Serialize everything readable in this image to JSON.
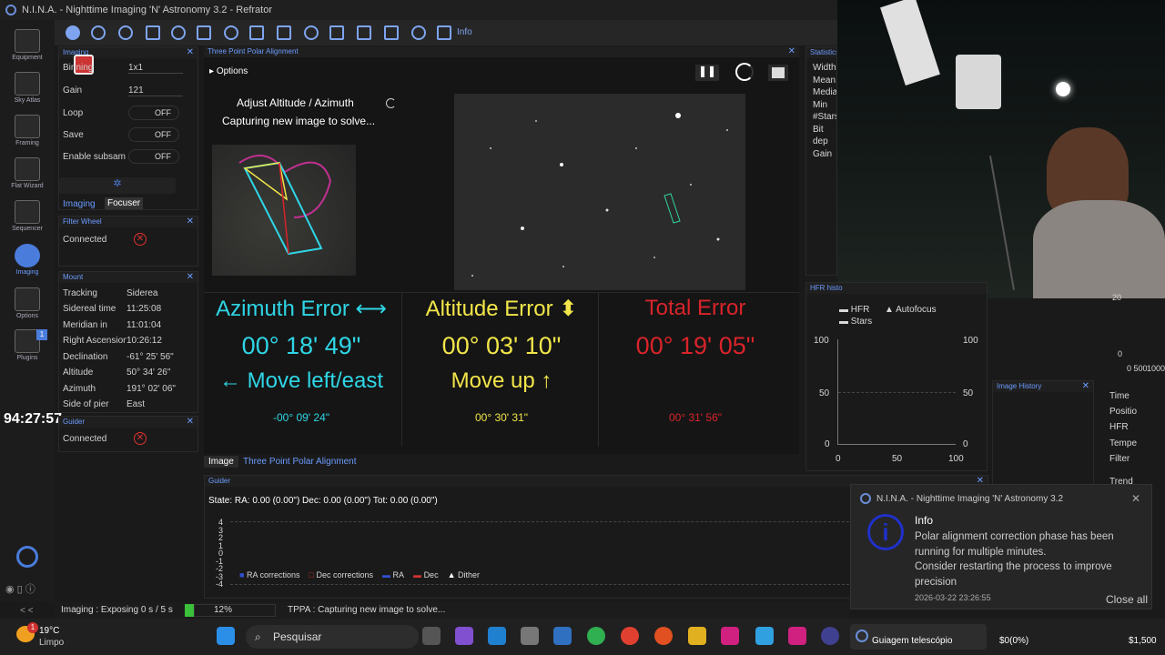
{
  "window": {
    "title": "N.I.N.A. - Nighttime Imaging 'N' Astronomy 3.2  -  Refrator"
  },
  "nav": [
    {
      "label": "Equipment"
    },
    {
      "label": "Sky Atlas"
    },
    {
      "label": "Framing"
    },
    {
      "label": "Flat Wizard"
    },
    {
      "label": "Sequencer"
    },
    {
      "label": "Imaging"
    },
    {
      "label": "Options"
    },
    {
      "label": "Plugins",
      "badge": "1"
    }
  ],
  "nav_bottom": "< <",
  "clock_overlay": "94:27:57",
  "toolbar": {
    "info": "Info"
  },
  "imaging_panel": {
    "title": "Imaging",
    "rows": [
      {
        "label": "Binning",
        "value": "1x1"
      },
      {
        "label": "Gain",
        "value": "121"
      },
      {
        "label": "Loop",
        "value": "OFF"
      },
      {
        "label": "Save",
        "value": "OFF"
      },
      {
        "label": "Enable subsam",
        "value": "OFF"
      }
    ],
    "tabs": [
      "Imaging",
      "Focuser"
    ]
  },
  "filter_wheel": {
    "title": "Filter Wheel",
    "status": "Connected"
  },
  "mount": {
    "title": "Mount",
    "rows": [
      {
        "label": "Tracking",
        "value": "Siderea"
      },
      {
        "label": "Sidereal time",
        "value": "11:25:08"
      },
      {
        "label": "Meridian in",
        "value": "11:01:04"
      },
      {
        "label": "Right Ascension",
        "value": "10:26:12"
      },
      {
        "label": "Declination",
        "value": "-61° 25' 56\""
      },
      {
        "label": "Altitude",
        "value": "50° 34' 26\""
      },
      {
        "label": "Azimuth",
        "value": "191° 02' 06\""
      },
      {
        "label": "Side of pier",
        "value": "East"
      }
    ]
  },
  "guider_small": {
    "title": "Guider",
    "status": "Connected"
  },
  "tppa": {
    "title": "Three Point Polar Alignment",
    "options": "Options",
    "step": "Adjust Altitude / Azimuth",
    "status": "Capturing new image to solve...",
    "azimuth": {
      "label": "Azimuth Error ⟷",
      "value": "00° 18' 49\"",
      "instruction": "← Move left/east",
      "detail": "-00° 09' 24\""
    },
    "altitude": {
      "label": "Altitude Error ⬍",
      "value": "00° 03' 10\"",
      "instruction": "Move up ↑",
      "detail": "00° 30' 31\""
    },
    "total": {
      "label": "Total Error",
      "value": "00° 19' 05\"",
      "detail": "00° 31' 56\""
    },
    "tabs": [
      "Image",
      "Three Point Polar Alignment"
    ]
  },
  "colors": {
    "azimuth": "#2fd6e6",
    "altitude": "#f2e64a",
    "total": "#d8242a",
    "accent": "#6c9cff"
  },
  "statistics": {
    "title": "Statistics",
    "rows": [
      "Width",
      "Mean",
      "Media",
      "Min",
      "#Stars",
      "Bit dep",
      "Gain"
    ]
  },
  "hfr": {
    "title": "HFR histo",
    "legend": [
      "HFR",
      "Autofocus",
      "Stars"
    ],
    "y_ticks": [
      "100",
      "50",
      "0"
    ],
    "x_ticks": [
      "0",
      "50",
      "100"
    ]
  },
  "image_history": {
    "title": "Image History"
  },
  "right_col": {
    "rows": [
      "Time",
      "Positio",
      "HFR",
      "Tempe",
      "Filter",
      "Trend"
    ],
    "ticks": [
      "20",
      "0",
      "0 500",
      "1000"
    ]
  },
  "guider": {
    "title": "Guider",
    "state": "State:  RA: 0.00 (0.00\")  Dec: 0.00 (0.00\")  Tot: 0.00 (0.00\")",
    "y_ticks": [
      "4",
      "3",
      "2",
      "1",
      "0",
      "-1",
      "-2",
      "-3",
      "-4"
    ],
    "legend": [
      "RA corrections",
      "Dec corrections",
      "RA",
      "Dec",
      "Dither"
    ]
  },
  "statusbar": {
    "imaging": "Imaging :   Exposing 0 s / 5 s",
    "progress": "12%",
    "tppa": "TPPA :   Capturing new image to solve..."
  },
  "notification": {
    "app": "N.I.N.A. - Nighttime Imaging 'N' Astronomy 3.2",
    "title": "Info",
    "line1": "Polar alignment correction phase has been running for multiple minutes.",
    "line2": "Consider restarting the process to improve precision",
    "time": "2026-03-22 23:26:55",
    "close_all": "Close all"
  },
  "taskbar": {
    "temp": "19°C",
    "weather": "Limpo",
    "weather_badge": "1",
    "search": "Pesquisar",
    "active_app": "Guiagem telescópio",
    "money": "$0(0%)",
    "price": "$1,500"
  }
}
